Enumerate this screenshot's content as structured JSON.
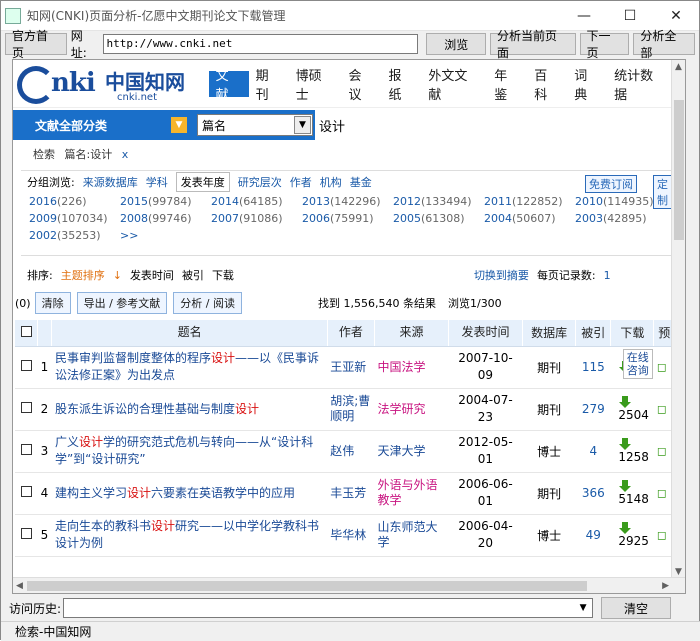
{
  "window": {
    "title": "知网(CNKI)页面分析-亿愿中文期刊论文下载管理",
    "minimize": "—",
    "maximize": "☐",
    "close": "✕"
  },
  "toolbar": {
    "home_label": "官方首页",
    "url_label": "网址:",
    "url_value": "http://www.cnki.net",
    "browse_label": "浏览",
    "analyze_label": "分析当前页面",
    "next_label": "下一页",
    "analyze_all_label": "分析全部"
  },
  "cnki": {
    "logo_text": "nki",
    "logo_cn": "中国知网",
    "logo_url": "cnki.net",
    "nav": [
      "文献",
      "期刊",
      "博硕士",
      "会议",
      "报纸",
      "外文文献",
      "年鉴",
      "百科",
      "词典",
      "统计数据"
    ],
    "category_label": "文献全部分类",
    "field_value": "篇名",
    "query_value": "设计",
    "crumb": [
      "检索",
      "篇名:设计",
      "x"
    ]
  },
  "grouping": {
    "label": "分组浏览:",
    "tabs": [
      "来源数据库",
      "学科",
      "发表年度",
      "研究层次",
      "作者",
      "机构",
      "基金"
    ],
    "active_tab": "发表年度",
    "subscribe_label": "免费订阅",
    "custom_label": "定制",
    "years": [
      [
        [
          "2016",
          "(226)"
        ],
        [
          "2015",
          "(99784)"
        ],
        [
          "2014",
          "(64185)"
        ],
        [
          "2013",
          "(142296)"
        ],
        [
          "2012",
          "(133494)"
        ],
        [
          "2011",
          "(122852)"
        ],
        [
          "2010",
          "(114935)"
        ]
      ],
      [
        [
          "2009",
          "(107034)"
        ],
        [
          "2008",
          "(99746)"
        ],
        [
          "2007",
          "(91086)"
        ],
        [
          "2006",
          "(75991)"
        ],
        [
          "2005",
          "(61308)"
        ],
        [
          "2004",
          "(50607)"
        ],
        [
          "2003",
          "(42895)"
        ]
      ],
      [
        [
          "2002",
          "(35253)"
        ],
        [
          ">>",
          ""
        ]
      ]
    ]
  },
  "sort": {
    "label": "排序:",
    "options": [
      "主题排序",
      "发表时间",
      "被引",
      "下载"
    ],
    "switch_label": "切换到摘要",
    "per_page_label": "每页记录数:",
    "per_page_value": "1"
  },
  "actions": {
    "selected": "(0)",
    "clear": "清除",
    "export": "导出 / 参考文献",
    "analyze": "分析 / 阅读",
    "found": "找到 1,556,540 条结果",
    "browse": "浏览1/300"
  },
  "table": {
    "headers": [
      "题名",
      "作者",
      "来源",
      "发表时间",
      "数据库",
      "被引",
      "下载",
      "预"
    ],
    "rows": [
      {
        "num": "1",
        "title_pre": "民事审判监督制度整体的程序",
        "hl": "设计",
        "title_post": "——以《民事诉讼法修正案》为出发点",
        "author": "王亚新",
        "source": "中国法学",
        "date": "2007-10-09",
        "db": "期刊",
        "cite": "115",
        "dl": "",
        "online": "在线咨询"
      },
      {
        "num": "2",
        "title_pre": "股东派生诉讼的合理性基础与制度",
        "hl": "设计",
        "title_post": "",
        "author": "胡滨;曹顺明",
        "source": "法学研究",
        "date": "2004-07-23",
        "db": "期刊",
        "cite": "279",
        "dl": "2504",
        "online": ""
      },
      {
        "num": "3",
        "title_pre": "广义",
        "hl": "设计",
        "title_post": "学的研究范式危机与转向——从“设计科学”到“设计研究”",
        "author": "赵伟",
        "source": "天津大学",
        "date": "2012-05-01",
        "db": "博士",
        "cite": "4",
        "dl": "1258",
        "online": ""
      },
      {
        "num": "4",
        "title_pre": "建构主义学习",
        "hl": "设计",
        "title_post": "六要素在英语教学中的应用",
        "author": "丰玉芳",
        "source": "外语与外语教学",
        "date": "2006-06-01",
        "db": "期刊",
        "cite": "366",
        "dl": "5148",
        "online": ""
      },
      {
        "num": "5",
        "title_pre": "走向生本的教科书",
        "hl": "设计",
        "title_post": "研究——以中学化学教科书设计为例",
        "author": "毕华林",
        "source": "山东师范大学",
        "date": "2006-04-20",
        "db": "博士",
        "cite": "49",
        "dl": "2925",
        "online": ""
      }
    ]
  },
  "history": {
    "label": "访问历史:",
    "value": "",
    "clear_label": "清空"
  },
  "status": {
    "text": "检索-中国知网"
  }
}
